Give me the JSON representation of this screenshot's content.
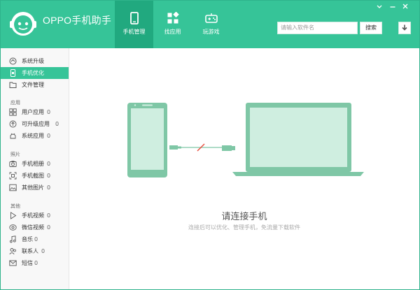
{
  "app": {
    "title": "OPPO手机助手"
  },
  "nav": {
    "tabs": [
      {
        "label": "手机管理",
        "icon": "phone-icon",
        "active": true
      },
      {
        "label": "找应用",
        "icon": "apps-icon",
        "active": false
      },
      {
        "label": "玩游戏",
        "icon": "gamepad-icon",
        "active": false
      }
    ]
  },
  "search": {
    "placeholder": "请输入软件名",
    "button_label": "搜索"
  },
  "sidebar": {
    "top_items": [
      {
        "label": "系统升级",
        "icon": "upgrade-icon",
        "active": false
      },
      {
        "label": "手机优化",
        "icon": "phone-optimize-icon",
        "active": true
      },
      {
        "label": "文件管理",
        "icon": "folder-icon",
        "active": false
      }
    ],
    "apps_section": {
      "title": "应用",
      "items": [
        {
          "label": "用户应用",
          "count": "0",
          "icon": "grid-icon"
        },
        {
          "label": "可升级应用",
          "count": "0",
          "icon": "up-circle-icon"
        },
        {
          "label": "系统应用",
          "count": "0",
          "icon": "android-icon"
        }
      ]
    },
    "photos_section": {
      "title": "照片",
      "items": [
        {
          "label": "手机相册",
          "count": "0",
          "icon": "camera-icon"
        },
        {
          "label": "手机截图",
          "count": "0",
          "icon": "screenshot-icon"
        },
        {
          "label": "其他图片",
          "count": "0",
          "icon": "image-icon"
        }
      ]
    },
    "other_section": {
      "title": "其他",
      "items": [
        {
          "label": "手机视频",
          "count": "0",
          "icon": "play-icon"
        },
        {
          "label": "微信视频",
          "count": "0",
          "icon": "wechat-video-icon"
        },
        {
          "label": "音乐",
          "count": "0",
          "icon": "music-icon"
        },
        {
          "label": "联系人",
          "count": "0",
          "icon": "contacts-icon"
        },
        {
          "label": "短信",
          "count": "0",
          "icon": "mail-icon"
        }
      ]
    }
  },
  "main": {
    "connect_title": "请连接手机",
    "connect_subtitle": "连接后可以优化、管理手机，免流量下载软件"
  },
  "colors": {
    "brand": "#36c498",
    "brand_dark": "#21a97f",
    "illustration": "#7fc7a6",
    "illustration_light": "#cfeee0",
    "error_red": "#e74c3c"
  }
}
